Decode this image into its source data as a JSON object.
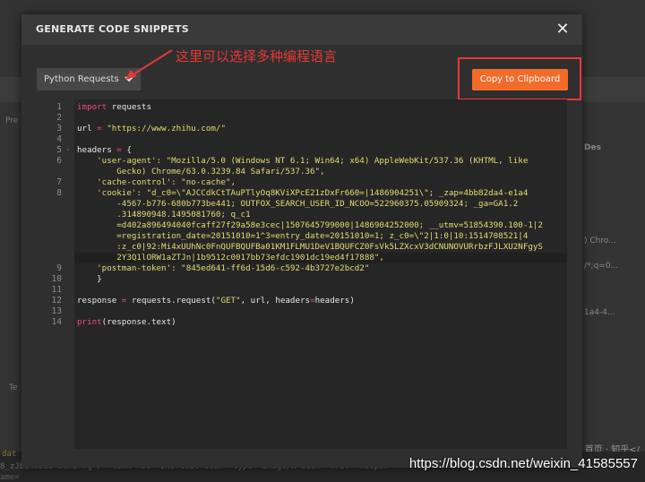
{
  "background": {
    "side_right": [
      "Des",
      ") Chro...",
      "/*;q=0...",
      "1a4-4..."
    ],
    "side_left": [
      "Pre",
      "Te"
    ],
    "footer_line1": "dat",
    "footer_line2": "8_zJbaWw53J-5ch9MTg\"/><link rel=\"shortcut icon\" type=\"image/x-icon\" href=\"https:",
    "footer_line3": "ame=",
    "crumb": "首页 · 知乎</",
    "watermark": "https://blog.csdn.net/weixin_41585557"
  },
  "modal": {
    "title": "GENERATE CODE SNIPPETS",
    "close_glyph": "✕",
    "language": "Python Requests",
    "copy_label": "Copy to Clipboard",
    "annotation": "这里可以选择多种编程语言"
  },
  "colors": {
    "accent": "#f26b2a",
    "annotation": "#e53935",
    "keyword": "#f24d7a",
    "string": "#e5db74"
  },
  "code": {
    "line_numbers": [
      "1",
      "2",
      "3",
      "4",
      "5",
      "6",
      "7",
      "8",
      "9",
      "10",
      "11",
      "12",
      "13",
      "14"
    ],
    "fold_marker": "-",
    "l1_kw": "import",
    "l1_rest": " requests",
    "l3_a": "url ",
    "l3_eq": "=",
    "l3_str": " \"https://www.zhihu.com/\"",
    "l5_a": "headers ",
    "l5_eq": "=",
    "l5_b": " {",
    "l6_str": "    'user-agent': \"Mozilla/5.0 (Windows NT 6.1; Win64; x64) AppleWebKit/537.36 (KHTML, like",
    "l6b_str": "        Gecko) Chrome/63.0.3239.84 Safari/537.36\",",
    "l7_str": "    'cache-control': \"no-cache\",",
    "l8_str": "    'cookie': \"d_c0=\\\"AJCCdkCtTAuPTlyOq8KViXPcE21zDxFr660=|1486904251\\\"; _zap=4bb82da4-e1a4",
    "l8b_str": "        -4567-b776-680b773be441; OUTFOX_SEARCH_USER_ID_NCOO=522960375.05909324; _ga=GA1.2",
    "l8c_str": "        .314890948.1495081760; q_c1",
    "l8d_str": "        =d402a896494040fcaff27f29a58e3cec|1507645799000|1486904252000; __utmv=51854390.100-1|2",
    "l8e_str": "        =registration_date=20151010=1^3=entry_date=20151010=1; z_c0=\\\"2|1:0|10:1514708521|4",
    "l8f_str": "        :z_c0|92:Mi4xUUhNc0FnQUFBQUFBa01KM1FLMU1DeV1BQUFCZ0FsVk5LZXcxV3dCNUNOVURrbzFJLXU2NFgyS",
    "l8g_str": "        2Y3Q1lORW1aZTJn|1b9512c0017bb73efdc1901dc19ed4f17888\",",
    "l9_str": "    'postman-token': \"845ed641-ff6d-15d6-c592-4b3727e2bcd2\"",
    "l10": "    }",
    "l12_a": "response ",
    "l12_eq": "=",
    "l12_b": " requests.request(",
    "l12_s": "\"GET\"",
    "l12_c": ", url, headers",
    "l12_eq2": "=",
    "l12_d": "headers)",
    "l14_kw": "print",
    "l14_rest": "(response.text)"
  }
}
